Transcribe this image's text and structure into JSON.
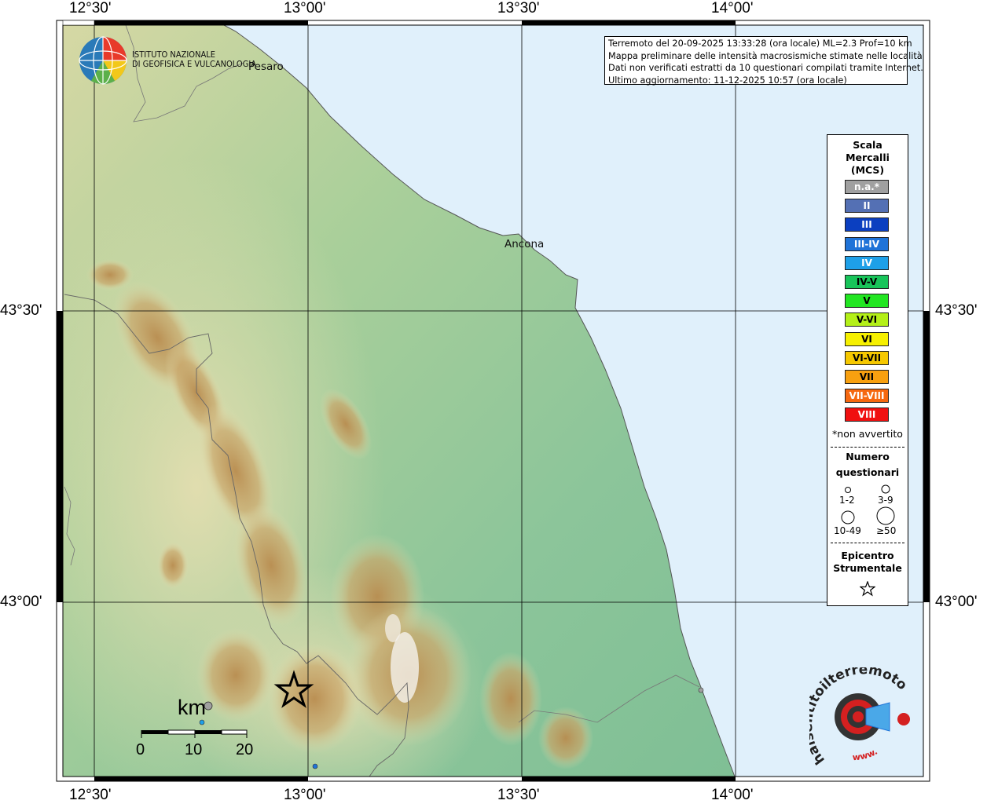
{
  "map": {
    "title_lines": [
      "Terremoto del 20-09-2025 13:33:28 (ora locale) ML=2.3 Prof=10 km",
      "Mappa preliminare delle intensità macrosismiche stimate nelle località",
      "Dati non verificati estratti da 10 questionari compilati tramite Internet.",
      "Ultimo aggiornamento: 11-12-2025 10:57 (ora locale)"
    ],
    "lon_ticks": [
      "12°30'",
      "13°00'",
      "13°30'",
      "14°00'"
    ],
    "lat_ticks": [
      "43°30'",
      "43°00'"
    ],
    "cities": [
      {
        "name": "Pesaro"
      },
      {
        "name": "Ancona"
      }
    ],
    "colors": {
      "sea": "#e0f0fb",
      "land_low": "#8cc59a",
      "land_mid": "#e4deb0",
      "mountain": "#b98c4f",
      "peak": "#f5f2ee"
    }
  },
  "institute": {
    "name_line1": "ISTITUTO NAZIONALE",
    "name_line2": "DI GEOFISICA E VULCANOLOGIA"
  },
  "legend": {
    "scale_title_1": "Scala",
    "scale_title_2": "Mercalli",
    "scale_title_3": "(MCS)",
    "classes": [
      {
        "label": "n.a.*",
        "color": "#a0a0a0"
      },
      {
        "label": "II",
        "color": "#5470b4"
      },
      {
        "label": "III",
        "color": "#0b3fc0"
      },
      {
        "label": "III-IV",
        "color": "#1f73d8"
      },
      {
        "label": "IV",
        "color": "#1ea0e8"
      },
      {
        "label": "IV-V",
        "color": "#18c45a"
      },
      {
        "label": "V",
        "color": "#22e622"
      },
      {
        "label": "V-VI",
        "color": "#b4f018"
      },
      {
        "label": "VI",
        "color": "#f6f000"
      },
      {
        "label": "VI-VII",
        "color": "#f6c800"
      },
      {
        "label": "VII",
        "color": "#f8a010"
      },
      {
        "label": "VII-VIII",
        "color": "#f66810"
      },
      {
        "label": "VIII",
        "color": "#f01010"
      }
    ],
    "not_felt_note": "*non avvertito",
    "count_title_1": "Numero",
    "count_title_2": "questionari",
    "counts": [
      "1-2",
      "3-9",
      "10-49",
      "≥50"
    ],
    "epicenter_title_1": "Epicentro",
    "epicenter_title_2": "Strumentale"
  },
  "scalebar": {
    "unit": "km",
    "labels": [
      "0",
      "10",
      "20"
    ]
  },
  "site_logo": {
    "text": "haisentitoilterremoto.it",
    "prefix": "www."
  },
  "observations": [
    {
      "intensity": "n.a.*",
      "count": "1-2"
    },
    {
      "intensity": "IV",
      "count": "1-2"
    },
    {
      "intensity": "III-IV",
      "count": "1-2"
    },
    {
      "intensity": "n.a.*",
      "count": "1-2"
    }
  ]
}
